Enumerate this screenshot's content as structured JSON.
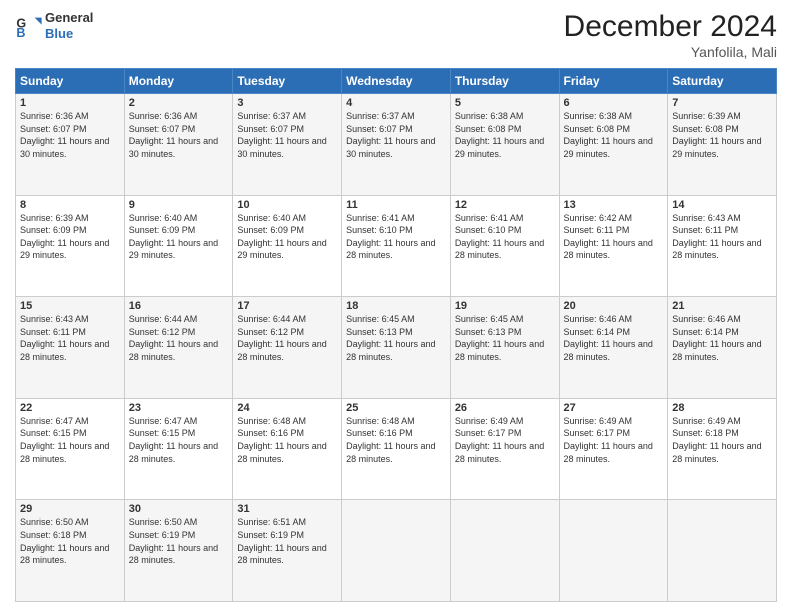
{
  "logo": {
    "text_general": "General",
    "text_blue": "Blue"
  },
  "title": "December 2024",
  "subtitle": "Yanfolila, Mali",
  "header_days": [
    "Sunday",
    "Monday",
    "Tuesday",
    "Wednesday",
    "Thursday",
    "Friday",
    "Saturday"
  ],
  "weeks": [
    [
      {
        "day": "1",
        "sunrise": "Sunrise: 6:36 AM",
        "sunset": "Sunset: 6:07 PM",
        "daylight": "Daylight: 11 hours and 30 minutes."
      },
      {
        "day": "2",
        "sunrise": "Sunrise: 6:36 AM",
        "sunset": "Sunset: 6:07 PM",
        "daylight": "Daylight: 11 hours and 30 minutes."
      },
      {
        "day": "3",
        "sunrise": "Sunrise: 6:37 AM",
        "sunset": "Sunset: 6:07 PM",
        "daylight": "Daylight: 11 hours and 30 minutes."
      },
      {
        "day": "4",
        "sunrise": "Sunrise: 6:37 AM",
        "sunset": "Sunset: 6:07 PM",
        "daylight": "Daylight: 11 hours and 30 minutes."
      },
      {
        "day": "5",
        "sunrise": "Sunrise: 6:38 AM",
        "sunset": "Sunset: 6:08 PM",
        "daylight": "Daylight: 11 hours and 29 minutes."
      },
      {
        "day": "6",
        "sunrise": "Sunrise: 6:38 AM",
        "sunset": "Sunset: 6:08 PM",
        "daylight": "Daylight: 11 hours and 29 minutes."
      },
      {
        "day": "7",
        "sunrise": "Sunrise: 6:39 AM",
        "sunset": "Sunset: 6:08 PM",
        "daylight": "Daylight: 11 hours and 29 minutes."
      }
    ],
    [
      {
        "day": "8",
        "sunrise": "Sunrise: 6:39 AM",
        "sunset": "Sunset: 6:09 PM",
        "daylight": "Daylight: 11 hours and 29 minutes."
      },
      {
        "day": "9",
        "sunrise": "Sunrise: 6:40 AM",
        "sunset": "Sunset: 6:09 PM",
        "daylight": "Daylight: 11 hours and 29 minutes."
      },
      {
        "day": "10",
        "sunrise": "Sunrise: 6:40 AM",
        "sunset": "Sunset: 6:09 PM",
        "daylight": "Daylight: 11 hours and 29 minutes."
      },
      {
        "day": "11",
        "sunrise": "Sunrise: 6:41 AM",
        "sunset": "Sunset: 6:10 PM",
        "daylight": "Daylight: 11 hours and 28 minutes."
      },
      {
        "day": "12",
        "sunrise": "Sunrise: 6:41 AM",
        "sunset": "Sunset: 6:10 PM",
        "daylight": "Daylight: 11 hours and 28 minutes."
      },
      {
        "day": "13",
        "sunrise": "Sunrise: 6:42 AM",
        "sunset": "Sunset: 6:11 PM",
        "daylight": "Daylight: 11 hours and 28 minutes."
      },
      {
        "day": "14",
        "sunrise": "Sunrise: 6:43 AM",
        "sunset": "Sunset: 6:11 PM",
        "daylight": "Daylight: 11 hours and 28 minutes."
      }
    ],
    [
      {
        "day": "15",
        "sunrise": "Sunrise: 6:43 AM",
        "sunset": "Sunset: 6:11 PM",
        "daylight": "Daylight: 11 hours and 28 minutes."
      },
      {
        "day": "16",
        "sunrise": "Sunrise: 6:44 AM",
        "sunset": "Sunset: 6:12 PM",
        "daylight": "Daylight: 11 hours and 28 minutes."
      },
      {
        "day": "17",
        "sunrise": "Sunrise: 6:44 AM",
        "sunset": "Sunset: 6:12 PM",
        "daylight": "Daylight: 11 hours and 28 minutes."
      },
      {
        "day": "18",
        "sunrise": "Sunrise: 6:45 AM",
        "sunset": "Sunset: 6:13 PM",
        "daylight": "Daylight: 11 hours and 28 minutes."
      },
      {
        "day": "19",
        "sunrise": "Sunrise: 6:45 AM",
        "sunset": "Sunset: 6:13 PM",
        "daylight": "Daylight: 11 hours and 28 minutes."
      },
      {
        "day": "20",
        "sunrise": "Sunrise: 6:46 AM",
        "sunset": "Sunset: 6:14 PM",
        "daylight": "Daylight: 11 hours and 28 minutes."
      },
      {
        "day": "21",
        "sunrise": "Sunrise: 6:46 AM",
        "sunset": "Sunset: 6:14 PM",
        "daylight": "Daylight: 11 hours and 28 minutes."
      }
    ],
    [
      {
        "day": "22",
        "sunrise": "Sunrise: 6:47 AM",
        "sunset": "Sunset: 6:15 PM",
        "daylight": "Daylight: 11 hours and 28 minutes."
      },
      {
        "day": "23",
        "sunrise": "Sunrise: 6:47 AM",
        "sunset": "Sunset: 6:15 PM",
        "daylight": "Daylight: 11 hours and 28 minutes."
      },
      {
        "day": "24",
        "sunrise": "Sunrise: 6:48 AM",
        "sunset": "Sunset: 6:16 PM",
        "daylight": "Daylight: 11 hours and 28 minutes."
      },
      {
        "day": "25",
        "sunrise": "Sunrise: 6:48 AM",
        "sunset": "Sunset: 6:16 PM",
        "daylight": "Daylight: 11 hours and 28 minutes."
      },
      {
        "day": "26",
        "sunrise": "Sunrise: 6:49 AM",
        "sunset": "Sunset: 6:17 PM",
        "daylight": "Daylight: 11 hours and 28 minutes."
      },
      {
        "day": "27",
        "sunrise": "Sunrise: 6:49 AM",
        "sunset": "Sunset: 6:17 PM",
        "daylight": "Daylight: 11 hours and 28 minutes."
      },
      {
        "day": "28",
        "sunrise": "Sunrise: 6:49 AM",
        "sunset": "Sunset: 6:18 PM",
        "daylight": "Daylight: 11 hours and 28 minutes."
      }
    ],
    [
      {
        "day": "29",
        "sunrise": "Sunrise: 6:50 AM",
        "sunset": "Sunset: 6:18 PM",
        "daylight": "Daylight: 11 hours and 28 minutes."
      },
      {
        "day": "30",
        "sunrise": "Sunrise: 6:50 AM",
        "sunset": "Sunset: 6:19 PM",
        "daylight": "Daylight: 11 hours and 28 minutes."
      },
      {
        "day": "31",
        "sunrise": "Sunrise: 6:51 AM",
        "sunset": "Sunset: 6:19 PM",
        "daylight": "Daylight: 11 hours and 28 minutes."
      },
      null,
      null,
      null,
      null
    ]
  ]
}
